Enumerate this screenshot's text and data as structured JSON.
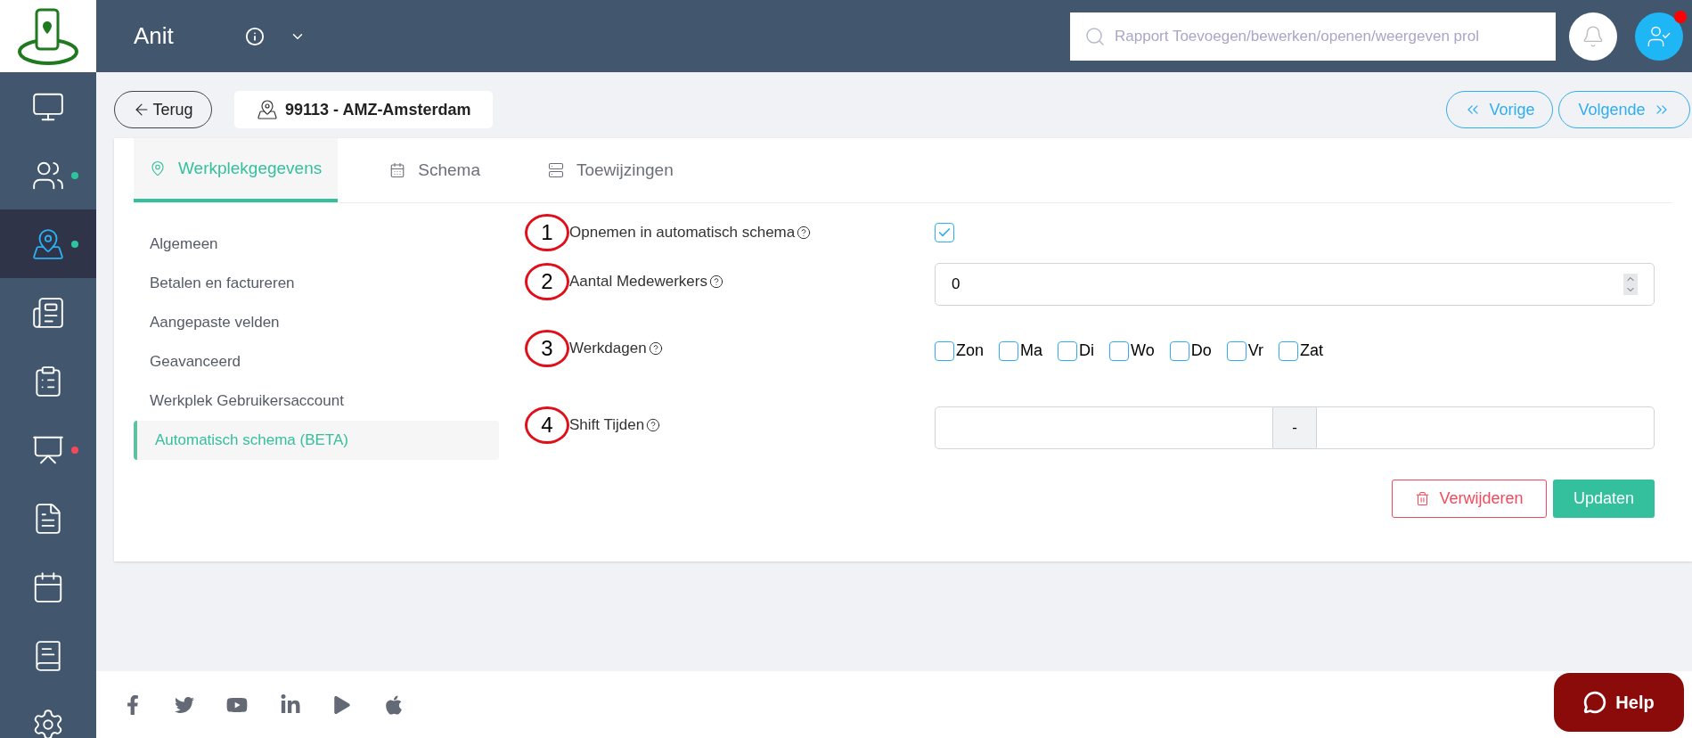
{
  "app": {
    "title": "Anit"
  },
  "search": {
    "placeholder": "Rapport Toevoegen/bewerken/openen/weergeven prol"
  },
  "profile": {
    "has_notification": true
  },
  "sidebar": {
    "items": [
      {
        "selected": false
      },
      {
        "selected": false,
        "color": "#2ec4a0"
      },
      {
        "selected": true,
        "color": "#2ec4a0"
      },
      {
        "selected": false
      },
      {
        "selected": false
      },
      {
        "selected": false,
        "color": "#f2495c"
      },
      {
        "selected": false
      },
      {
        "selected": false
      },
      {
        "selected": false
      },
      {
        "selected": false
      }
    ]
  },
  "back_button": "Terug",
  "location": "99113 - AMZ-Amsterdam",
  "nav": {
    "previous": "Vorige",
    "next": "Volgende"
  },
  "tabs": [
    {
      "label": "Werkplekgegevens",
      "selected": true
    },
    {
      "label": "Schema",
      "selected": false
    },
    {
      "label": "Toewijzingen",
      "selected": false
    }
  ],
  "menu": [
    {
      "label": "Algemeen",
      "selected": false
    },
    {
      "label": "Betalen en factureren",
      "selected": false
    },
    {
      "label": "Aangepaste velden",
      "selected": false
    },
    {
      "label": "Geavanceerd",
      "selected": false
    },
    {
      "label": "Werkplek Gebruikersaccount",
      "selected": false
    },
    {
      "label": "Automatisch schema (BETA)",
      "selected": true
    }
  ],
  "form": {
    "rows": [
      {
        "marker": "1",
        "label": "Opnemen in automatisch schema",
        "kind": "checkbox",
        "checked": true
      },
      {
        "marker": "2",
        "label": "Aantal Medewerkers",
        "kind": "number",
        "value": "0"
      },
      {
        "marker": "3",
        "label": "Werkdagen",
        "kind": "days",
        "days": [
          {
            "label": "Zon",
            "checked": false
          },
          {
            "label": "Ma",
            "checked": false
          },
          {
            "label": "Di",
            "checked": false
          },
          {
            "label": "Wo",
            "checked": false
          },
          {
            "label": "Do",
            "checked": false
          },
          {
            "label": "Vr",
            "checked": false
          },
          {
            "label": "Zat",
            "checked": false
          }
        ]
      },
      {
        "marker": "4",
        "label": "Shift Tijden",
        "kind": "range",
        "separator": "-"
      }
    ]
  },
  "actions": {
    "delete": "Verwijderen",
    "update": "Updaten"
  },
  "help": "Help"
}
